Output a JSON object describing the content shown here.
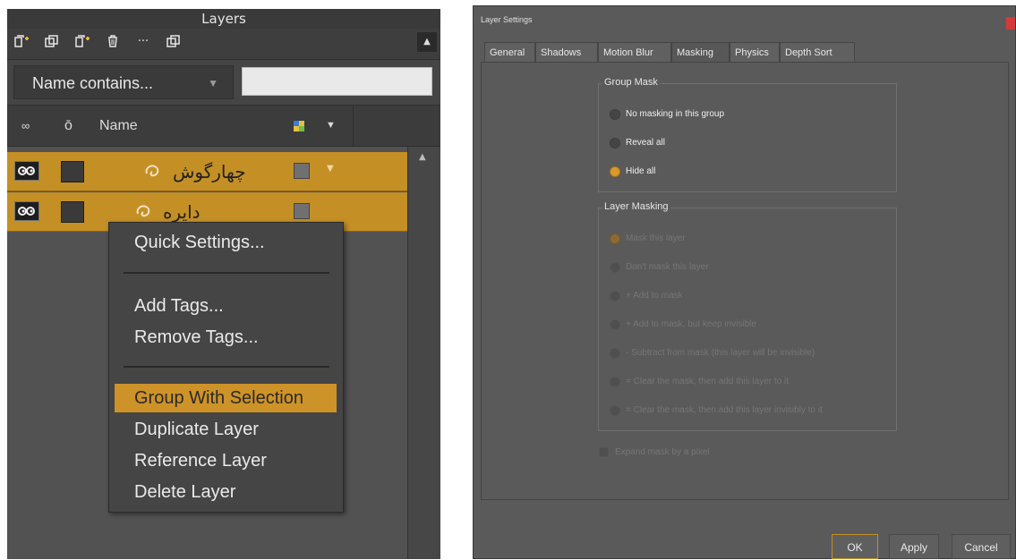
{
  "layers_panel": {
    "title": "Layers",
    "toolbar": {
      "icons": [
        "new-layer-icon",
        "new-group-icon",
        "new-layer-plus-icon",
        "trash-icon",
        "more-icon",
        "duplicate-icon"
      ],
      "more_label": "···"
    },
    "filter": {
      "select_value": "Name contains...",
      "input_value": ""
    },
    "header": {
      "name_label": "Name"
    },
    "rows": [
      {
        "name": "چهارگوش",
        "selected": true
      },
      {
        "name": "دایره",
        "selected": true
      }
    ]
  },
  "context_menu": {
    "items": [
      {
        "label": "Quick Settings..."
      },
      {
        "label": "Add Tags..."
      },
      {
        "label": "Remove Tags..."
      },
      {
        "label": "Group With Selection",
        "highlighted": true
      },
      {
        "label": "Duplicate Layer"
      },
      {
        "label": "Reference Layer"
      },
      {
        "label": "Delete Layer"
      }
    ]
  },
  "settings_dialog": {
    "title": "Layer Settings",
    "tabs": [
      "General",
      "Shadows",
      "Motion Blur",
      "Masking",
      "Physics",
      "Depth Sort"
    ],
    "active_tab": "Masking",
    "group_mask": {
      "title": "Group Mask",
      "options": [
        "No masking in this group",
        "Reveal all",
        "Hide all"
      ],
      "selected": "Hide all"
    },
    "layer_masking": {
      "title": "Layer Masking",
      "options": [
        "Mask this layer",
        "Don't mask this layer",
        "+ Add to mask",
        "+ Add to mask, but keep invisible",
        "- Subtract from mask (this layer will be invisible)",
        "= Clear the mask, then add this layer to it",
        "= Clear the mask, then add this layer invisibly to it"
      ],
      "selected": "Mask this layer"
    },
    "expand_mask_label": "Expand mask by a pixel",
    "buttons": {
      "ok": "OK",
      "apply": "Apply",
      "cancel": "Cancel"
    }
  },
  "colors": {
    "accent": "#c48f25",
    "panel_bg": "#4a4a4a",
    "dialog_bg": "#5a5a5a",
    "highlight": "#cd9228"
  }
}
